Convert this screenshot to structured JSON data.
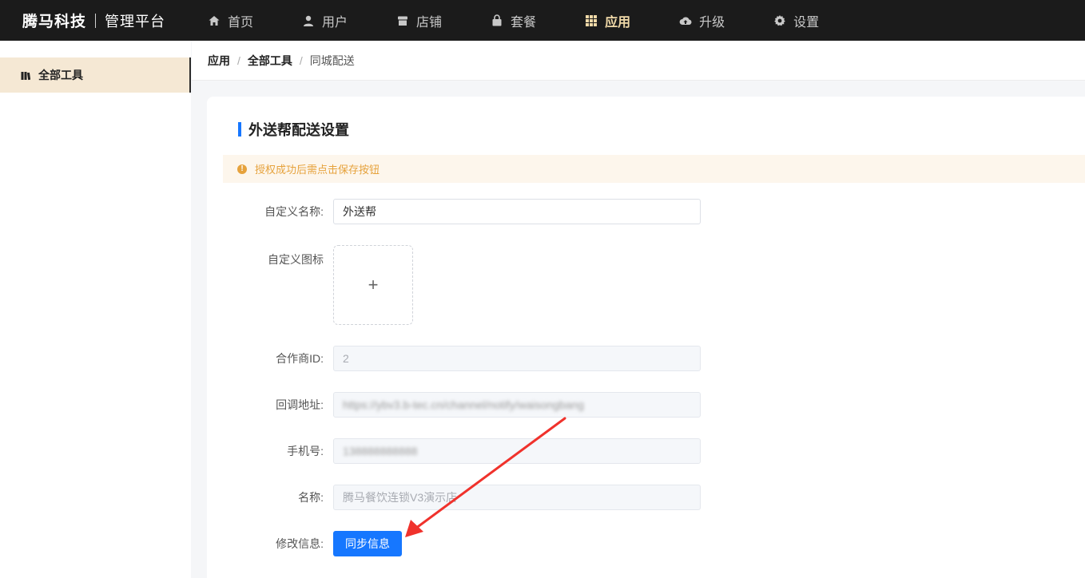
{
  "brand": {
    "name": "腾马科技",
    "subtitle": "管理平台"
  },
  "nav": {
    "items": [
      {
        "label": "首页",
        "icon": "home-icon",
        "active": false
      },
      {
        "label": "用户",
        "icon": "user-icon",
        "active": false
      },
      {
        "label": "店铺",
        "icon": "store-icon",
        "active": false
      },
      {
        "label": "套餐",
        "icon": "bag-icon",
        "active": false
      },
      {
        "label": "应用",
        "icon": "grid-icon",
        "active": true
      },
      {
        "label": "升级",
        "icon": "cloud-upload-icon",
        "active": false
      },
      {
        "label": "设置",
        "icon": "gear-icon",
        "active": false
      }
    ]
  },
  "sidebar": {
    "items": [
      {
        "label": "全部工具",
        "icon": "book-icon",
        "active": true
      }
    ]
  },
  "breadcrumb": {
    "items": [
      "应用",
      "全部工具",
      "同城配送"
    ],
    "separator": "/"
  },
  "card": {
    "title": "外送帮配送设置",
    "alert": "授权成功后需点击保存按钮"
  },
  "form": {
    "custom_name": {
      "label": "自定义名称:",
      "value": "外送帮"
    },
    "custom_icon": {
      "label": "自定义图标",
      "upload_symbol": "+"
    },
    "partner_id": {
      "label": "合作商ID:",
      "value": "2"
    },
    "callback": {
      "label": "回调地址:",
      "value": "https://ybv3.b-tec.cn/channel/notify/waisongbang"
    },
    "phone": {
      "label": "手机号:",
      "value": "138888888888"
    },
    "name": {
      "label": "名称:",
      "value": "腾马餐饮连锁V3演示店"
    },
    "modify": {
      "label": "修改信息:",
      "button": "同步信息"
    }
  },
  "colors": {
    "accent": "#1677ff",
    "nav_active": "#f0d9a8",
    "sidebar_active_bg": "#f5e8d4",
    "warning": "#e6a23c",
    "annotation_arrow": "#f0322c"
  }
}
